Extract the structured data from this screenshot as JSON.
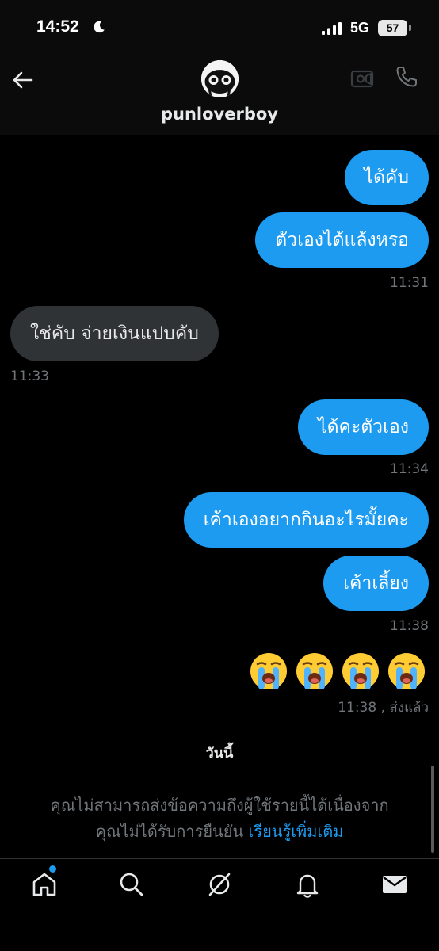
{
  "status_bar": {
    "time": "14:52",
    "network": "5G",
    "battery": "57",
    "icons": [
      "moon-icon",
      "signal-icon",
      "battery-icon"
    ]
  },
  "header": {
    "contact_name": "punloverboy",
    "icons": [
      "back-arrow-icon",
      "avatar",
      "video-call-icon",
      "phone-call-icon"
    ]
  },
  "messages": [
    {
      "side": "out",
      "text": "ได้คับ"
    },
    {
      "side": "out",
      "text": "ตัวเองได้แล้งหรอ",
      "time": "11:31"
    },
    {
      "side": "in",
      "text": "ใช่คับ จ่ายเงินแปบคับ",
      "time": "11:33"
    },
    {
      "side": "out",
      "text": "ได้คะตัวเอง",
      "time": "11:34"
    },
    {
      "side": "out",
      "text": "เค้าเองอยากกินอะไรมั้ยคะ"
    },
    {
      "side": "out",
      "text": "เค้าเลี้ยง",
      "time": "11:38"
    },
    {
      "side": "out",
      "emoji": [
        "loudly-crying-face",
        "loudly-crying-face",
        "loudly-crying-face",
        "loudly-crying-face"
      ],
      "time": "11:38",
      "status": "ส่งแล้ว"
    }
  ],
  "meta_sent": "11:38 , ส่งแล้ว",
  "day_divider": "วันนี้",
  "notice": {
    "line1": "คุณไม่สามารถส่งข้อความถึงผู้ใช้รายนี้ได้เนื่องจาก",
    "line2": "คุณไม่ได้รับการยืนยัน",
    "link": "เรียนรู้เพิ่มเติม"
  },
  "tab_bar": {
    "items": [
      "home-icon",
      "search-icon",
      "grok-icon",
      "notifications-icon",
      "messages-icon"
    ],
    "home_has_badge": true
  },
  "colors": {
    "accent": "#1d9bf0",
    "incoming_bubble": "#2f3336",
    "secondary_text": "#71767b",
    "background": "#000000"
  }
}
